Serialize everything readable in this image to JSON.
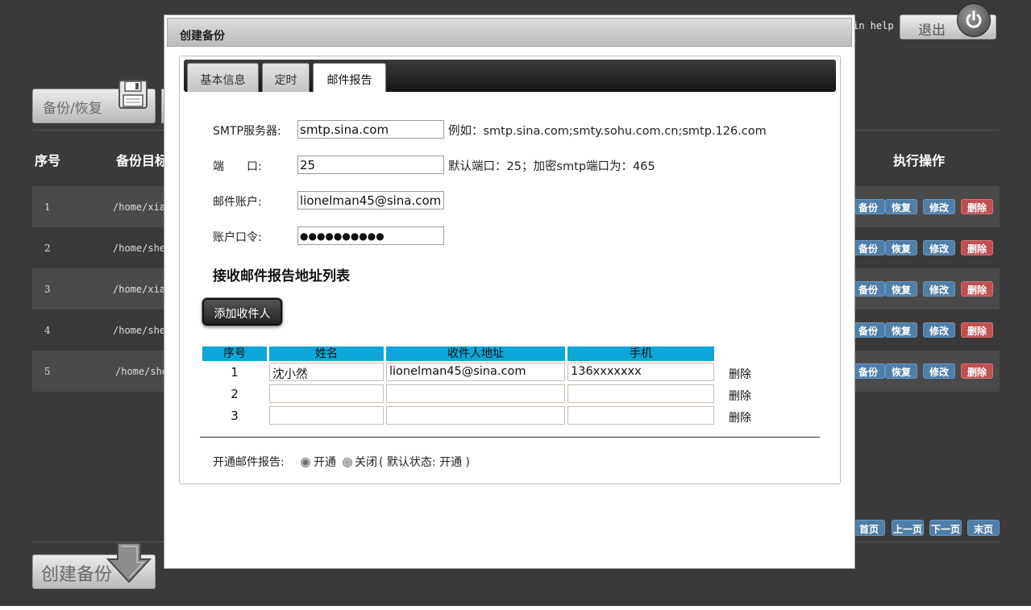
{
  "header": {
    "help_text": "in help",
    "logout_label": "退出",
    "power_icon": "power-icon"
  },
  "toolbar": {
    "backup_restore_label": "备份/恢复",
    "floppy_icon": "floppy-disk-icon"
  },
  "table": {
    "headers": {
      "index": "序号",
      "target": "备份目标",
      "actions": "执行操作"
    },
    "rows": [
      {
        "index": "1",
        "path": "/home/xia"
      },
      {
        "index": "2",
        "path": "/home/she"
      },
      {
        "index": "3",
        "path": "/home/xia"
      },
      {
        "index": "4",
        "path": "/home/she"
      },
      {
        "index": "5",
        "path": "/home/she"
      }
    ],
    "action_labels": {
      "backup": "备份",
      "restore": "恢复",
      "edit": "修改",
      "delete": "删除"
    }
  },
  "pager": {
    "first": "首页",
    "prev": "上一页",
    "next": "下一页",
    "last": "末页"
  },
  "create_backup_label": "创建备份",
  "modal": {
    "title": "创建备份",
    "tabs": [
      {
        "label": "基本信息",
        "active": false
      },
      {
        "label": "定时",
        "active": false
      },
      {
        "label": "邮件报告",
        "active": true
      }
    ],
    "smtp": {
      "label": "SMTP服务器:",
      "value": "smtp.sina.com",
      "hint": "例如：smtp.sina.com;smty.sohu.com.cn;smtp.126.com"
    },
    "port": {
      "label": "端　　口:",
      "value": "25",
      "hint": "默认端口：25；加密smtp端口为：465"
    },
    "account": {
      "label": "邮件账户:",
      "value": "lionelman45@sina.com"
    },
    "password": {
      "label": "账户口令:",
      "value": "●●●●●●●●●●"
    },
    "recipients_title": "接收邮件报告地址列表",
    "add_recipient_label": "添加收件人",
    "recipients_table": {
      "headers": {
        "index": "序号",
        "name": "姓名",
        "address": "收件人地址",
        "phone": "手机"
      },
      "rows": [
        {
          "index": "1",
          "name": "沈小然",
          "address": "lionelman45@sina.com",
          "phone": "136xxxxxxx"
        },
        {
          "index": "2",
          "name": "",
          "address": "",
          "phone": ""
        },
        {
          "index": "3",
          "name": "",
          "address": "",
          "phone": ""
        }
      ],
      "delete_label": "删除"
    },
    "enable_report": {
      "label": "开通邮件报告:",
      "on_label": "开通",
      "off_label": "关闭",
      "default_note": "( 默认状态: 开通 )",
      "selected": "on"
    }
  }
}
